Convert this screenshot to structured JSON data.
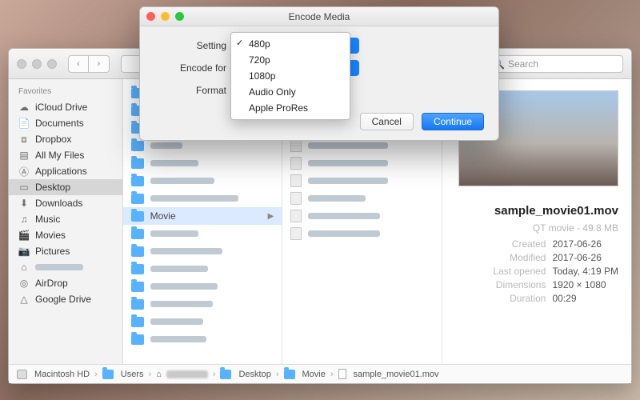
{
  "dialog": {
    "title": "Encode Media",
    "labels": {
      "setting": "Setting",
      "encode_for": "Encode for",
      "format": "Format"
    },
    "options": [
      "480p",
      "720p",
      "1080p",
      "Audio Only",
      "Apple ProRes"
    ],
    "selected_option": "480p",
    "cancel": "Cancel",
    "continue": "Continue"
  },
  "finder": {
    "search_placeholder": "Search",
    "sidebar": {
      "heading": "Favorites",
      "items": [
        {
          "label": "iCloud Drive",
          "icon": "cloud-icon"
        },
        {
          "label": "Documents",
          "icon": "document-icon"
        },
        {
          "label": "Dropbox",
          "icon": "dropbox-icon"
        },
        {
          "label": "All My Files",
          "icon": "allfiles-icon"
        },
        {
          "label": "Applications",
          "icon": "app-icon"
        },
        {
          "label": "Desktop",
          "icon": "desktop-icon"
        },
        {
          "label": "Downloads",
          "icon": "downloads-icon"
        },
        {
          "label": "Music",
          "icon": "music-icon"
        },
        {
          "label": "Movies",
          "icon": "movies-icon"
        },
        {
          "label": "Pictures",
          "icon": "pictures-icon"
        },
        {
          "label": "",
          "icon": "home-icon"
        },
        {
          "label": "AirDrop",
          "icon": "airdrop-icon"
        },
        {
          "label": "Google Drive",
          "icon": "gdrive-icon"
        }
      ],
      "selected_index": 5
    },
    "column_selected": "Movie",
    "preview": {
      "filename": "sample_movie01.mov",
      "kind_line": "QT movie - 49.8 MB",
      "rows": [
        {
          "k": "Created",
          "v": "2017-06-26"
        },
        {
          "k": "Modified",
          "v": "2017-06-26"
        },
        {
          "k": "Last opened",
          "v": "Today, 4:19 PM"
        },
        {
          "k": "Dimensions",
          "v": "1920 × 1080"
        },
        {
          "k": "Duration",
          "v": "00:29"
        }
      ]
    },
    "path": {
      "hd": "Macintosh HD",
      "users": "Users",
      "desktop": "Desktop",
      "movie": "Movie",
      "file": "sample_movie01.mov"
    }
  }
}
